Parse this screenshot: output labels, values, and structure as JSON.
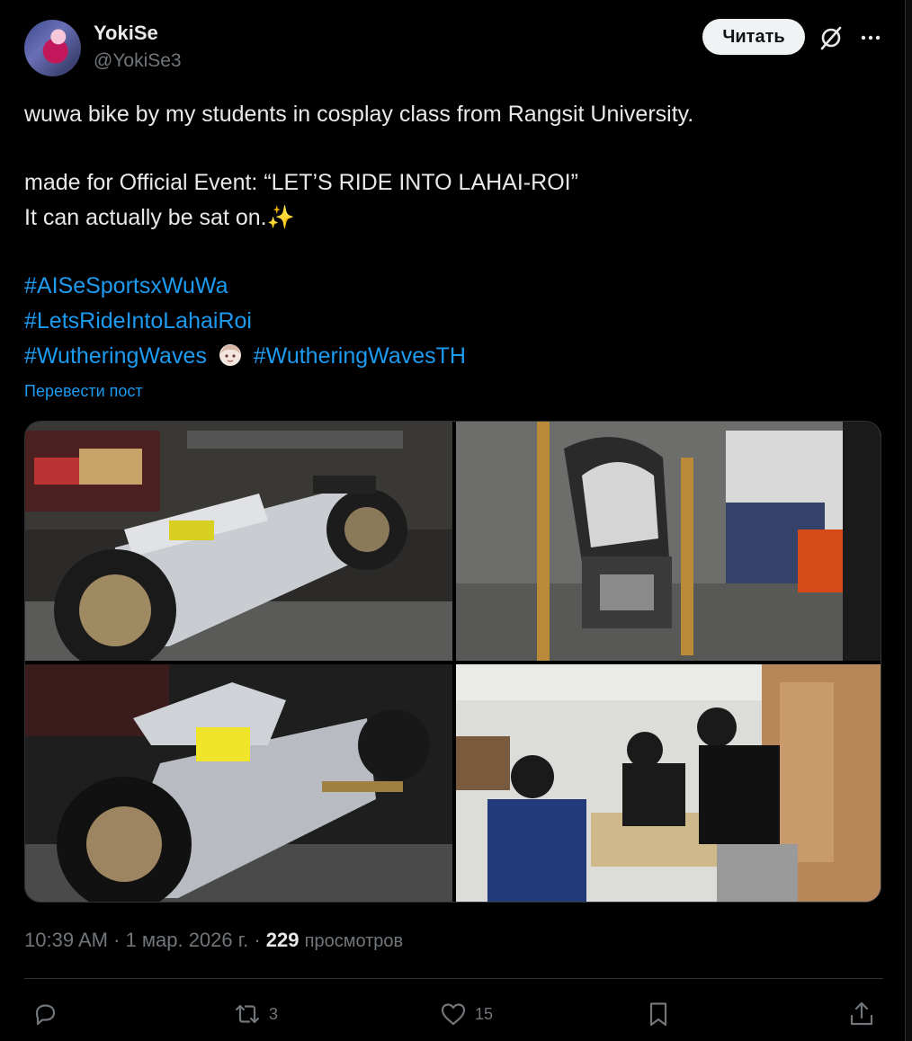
{
  "author": {
    "display_name": "YokiSe",
    "handle": "@YokiSe3"
  },
  "header": {
    "follow_label": "Читать"
  },
  "tweet": {
    "line1": "wuwa bike by my students in cosplay class from Rangsit University.",
    "line2": "made for Official Event: “LET’S RIDE INTO LAHAI-ROI”",
    "line3": "It can actually be sat on.✨",
    "hashtag1": "#AISeSportsxWuWa",
    "hashtag2": "#LetsRideIntoLahaiRoi",
    "hashtag3": "#WutheringWaves",
    "hashtag4": "#WutheringWavesTH",
    "translate_label": "Перевести пост"
  },
  "meta": {
    "time": "10:39 AM",
    "date": "1 мар. 2026 г.",
    "views_count": "229",
    "views_label": "просмотров"
  },
  "actions": {
    "reply_count": "",
    "repost_count": "3",
    "like_count": "15"
  },
  "colors": {
    "background": "#000000",
    "text": "#e7e9ea",
    "muted": "#71767b",
    "link": "#1d9bf0",
    "border": "#2f3336"
  },
  "icons": [
    "grok-icon",
    "more-icon",
    "reply-icon",
    "repost-icon",
    "like-icon",
    "bookmark-icon",
    "share-icon"
  ]
}
